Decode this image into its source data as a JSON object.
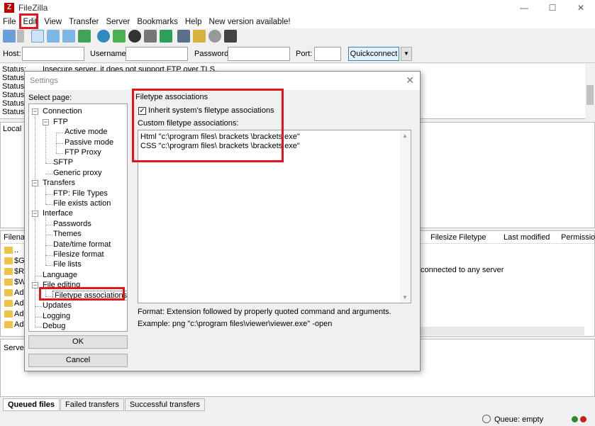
{
  "window": {
    "title": "FileZilla",
    "minimize": "—",
    "maximize": "☐",
    "close": "✕"
  },
  "menu": [
    "File",
    "Edit",
    "View",
    "Transfer",
    "Server",
    "Bookmarks",
    "Help",
    "New version available!"
  ],
  "quickconnect": {
    "host_label": "Host:",
    "username_label": "Username:",
    "password_label": "Password:",
    "port_label": "Port:",
    "button": "Quickconnect"
  },
  "log": {
    "status_label": "Status:",
    "message": "Insecure server, it does not support FTP over TLS."
  },
  "local_site_label": "Local s",
  "filelist": {
    "name_header": "Filenar",
    "columns": [
      "Filesize",
      "Filetype",
      "Last modified",
      "Permissions"
    ],
    "remote_message": "connected to any server",
    "items": [
      "..",
      "$Ge",
      "$Re",
      "$WI",
      "Ado",
      "Ado",
      "Ado",
      "Ado"
    ]
  },
  "queue": {
    "server_label": "Server/"
  },
  "tabs": [
    "Queued files",
    "Failed transfers",
    "Successful transfers"
  ],
  "status_bar": {
    "queue": "Queue: empty"
  },
  "dialog": {
    "title": "Settings",
    "close": "✕",
    "select_page_label": "Select page:",
    "tree": {
      "connection": "Connection",
      "ftp": "FTP",
      "active_mode": "Active mode",
      "passive_mode": "Passive mode",
      "ftp_proxy": "FTP Proxy",
      "sftp": "SFTP",
      "generic_proxy": "Generic proxy",
      "transfers": "Transfers",
      "ftp_file_types": "FTP: File Types",
      "file_exists_action": "File exists action",
      "interface": "Interface",
      "passwords": "Passwords",
      "themes": "Themes",
      "date_time_format": "Date/time format",
      "filesize_format": "Filesize format",
      "file_lists": "File lists",
      "language": "Language",
      "file_editing": "File editing",
      "filetype_associations": "Filetype associations",
      "updates": "Updates",
      "logging": "Logging",
      "debug": "Debug"
    },
    "ok": "OK",
    "cancel": "Cancel",
    "panel": {
      "group_title": "Filetype associations",
      "inherit_label": "Inherit system's filetype associations",
      "inherit_checked": true,
      "custom_label": "Custom filetype associations:",
      "associations": [
        "Html \"c:\\program files\\ brackets \\brackets.exe\"",
        "CSS \"c:\\program files\\ brackets \\brackets.exe\""
      ],
      "format_text": "Format: Extension followed by properly quoted command and arguments.",
      "example_text": "Example: png \"c:\\program files\\viewer\\viewer.exe\" -open"
    }
  },
  "colors": {
    "highlight_red": "#e3141b",
    "quickconnect_border": "#3c7fb1",
    "folder": "#f0c24a"
  }
}
